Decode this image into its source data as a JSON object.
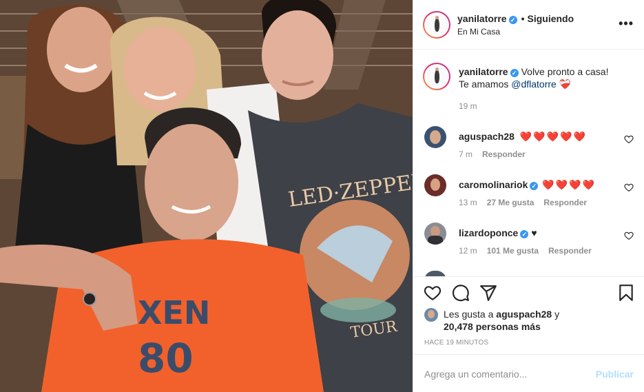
{
  "post": {
    "author": "yanilatorre",
    "follow_status": "Siguiendo",
    "location": "En Mi Casa",
    "caption_user": "yanilatorre",
    "caption_text": "Volve pronto a casa! Te amamos ",
    "caption_mention": "@dflatorre",
    "caption_emoji": "❤️‍🩹",
    "caption_time": "19 m"
  },
  "comments": [
    {
      "user": "aguspach28",
      "text": "❤️❤️❤️❤️❤️",
      "time": "7 m",
      "likes": "",
      "reply": "Responder",
      "verified": false
    },
    {
      "user": "caromolinariok",
      "text": "❤️❤️❤️❤️",
      "time": "13 m",
      "likes": "27 Me gusta",
      "reply": "Responder",
      "verified": true
    },
    {
      "user": "lizardoponce",
      "text": "♥",
      "time": "12 m",
      "likes": "101 Me gusta",
      "reply": "Responder",
      "verified": true
    }
  ],
  "likes": {
    "prefix": "Les gusta a",
    "user": "aguspach28",
    "connector": "y",
    "count": "20,478 personas más"
  },
  "time_ago": "HACE 19 MINUTOS",
  "comment_box": {
    "placeholder": "Agrega un comentario...",
    "publish_label": "Publicar"
  },
  "colors": {
    "link": "#00376b",
    "verified": "#3897f0",
    "muted": "#8e8e8e",
    "publish_disabled": "#b2dffc"
  },
  "icons": {
    "more": "more-horizontal-icon",
    "like": "heart-outline-icon",
    "comment": "comment-bubble-icon",
    "share": "paper-plane-icon",
    "save": "bookmark-icon"
  }
}
